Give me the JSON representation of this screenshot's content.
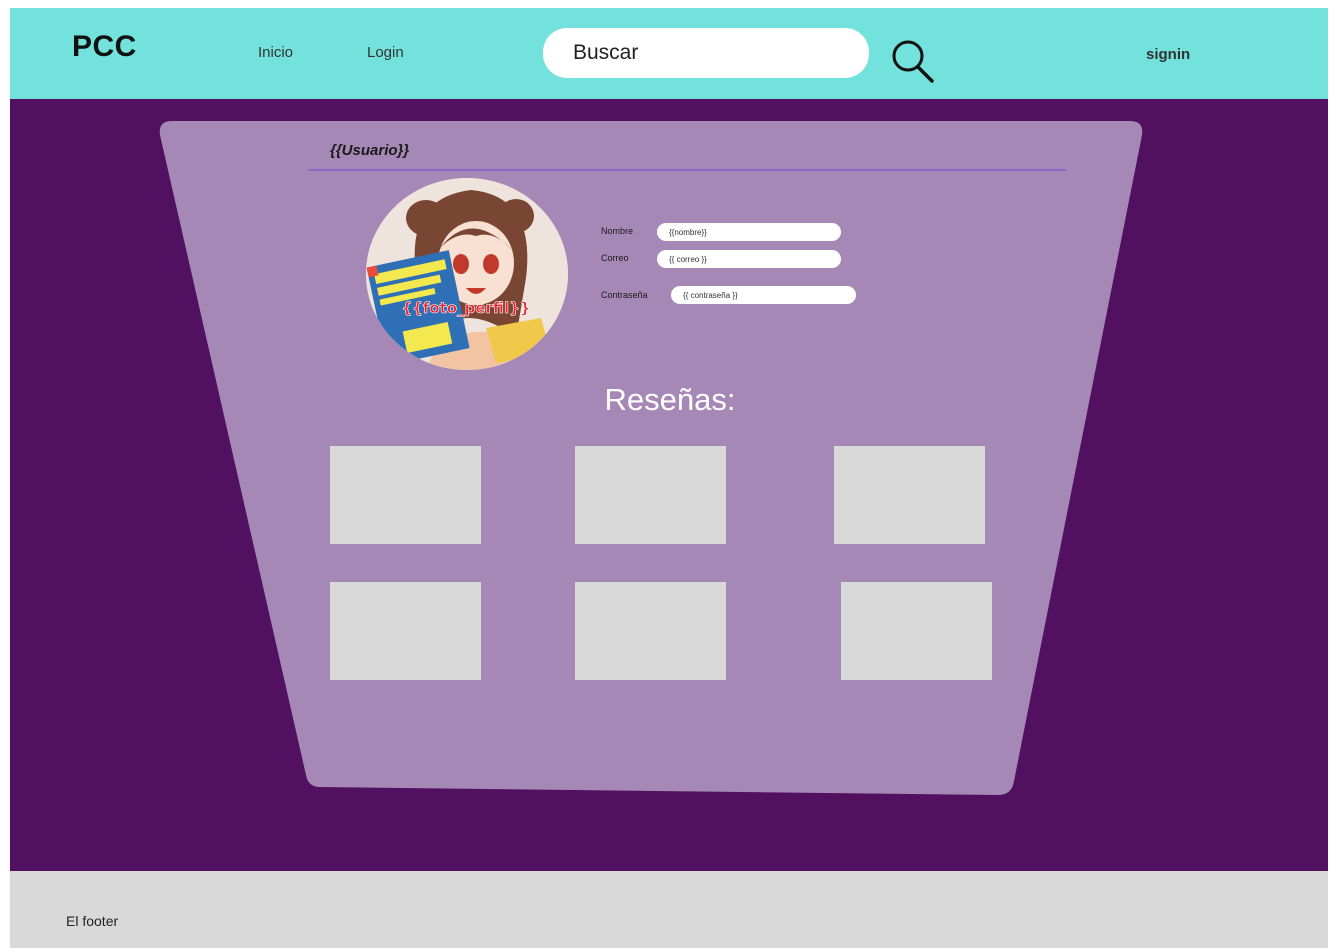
{
  "header": {
    "logo": "PCC",
    "nav_inicio": "Inicio",
    "nav_login": "Login",
    "search_placeholder": "Buscar",
    "signin": "signin"
  },
  "profile": {
    "username": "{{Usuario}}",
    "avatar_caption": "{{foto_perfil}}",
    "fields": {
      "nombre_label": "Nombre",
      "nombre_value": "{{nombre}}",
      "correo_label": "Correo",
      "correo_value": "{{ correo }}",
      "contrasena_label": "Contraseña",
      "contrasena_value": "{{ contraseña }}"
    }
  },
  "reviews": {
    "title": "Reseñas:",
    "count": 6
  },
  "footer": {
    "text": "El footer"
  },
  "colors": {
    "header_bg": "#74e2dc",
    "main_bg": "#511160",
    "card_bg": "#a688b6",
    "divider": "#8b68c4",
    "review_placeholder": "#d9d9d9",
    "footer_bg": "#d9d9d9"
  },
  "icons": {
    "search": "magnifier-icon"
  }
}
